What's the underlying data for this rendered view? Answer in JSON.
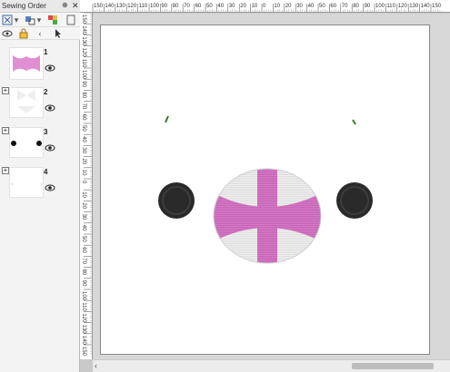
{
  "panel": {
    "title": "Sewing Order",
    "pin_glyph": "⊕",
    "close_glyph": "✕"
  },
  "items": [
    {
      "number": "1",
      "has_expander": false
    },
    {
      "number": "2",
      "has_expander": true
    },
    {
      "number": "3",
      "has_expander": true
    },
    {
      "number": "4",
      "has_expander": true
    }
  ],
  "ruler": {
    "h_labels": [
      "150",
      "140",
      "130",
      "120",
      "110",
      "100",
      "90",
      "80",
      "70",
      "60",
      "50",
      "40",
      "30",
      "20",
      "10",
      "0",
      "10",
      "20",
      "30",
      "40",
      "50",
      "60",
      "70",
      "80",
      "90",
      "100",
      "110",
      "120",
      "130",
      "140",
      "150"
    ],
    "v_labels": [
      "150",
      "140",
      "130",
      "120",
      "110",
      "100",
      "90",
      "80",
      "70",
      "60",
      "50",
      "40",
      "30",
      "20",
      "10",
      "0",
      "10",
      "20",
      "30",
      "40",
      "50",
      "60",
      "70",
      "80",
      "90",
      "100",
      "110",
      "120",
      "130",
      "140",
      "150"
    ]
  },
  "scroll": {
    "left_arrow": "‹"
  },
  "colors": {
    "pink": "#d878c8",
    "pink_dark": "#b55aa5",
    "stitch_white": "#ececec",
    "eye_dark": "#2a2a2a",
    "green": "#3a7a2a"
  }
}
